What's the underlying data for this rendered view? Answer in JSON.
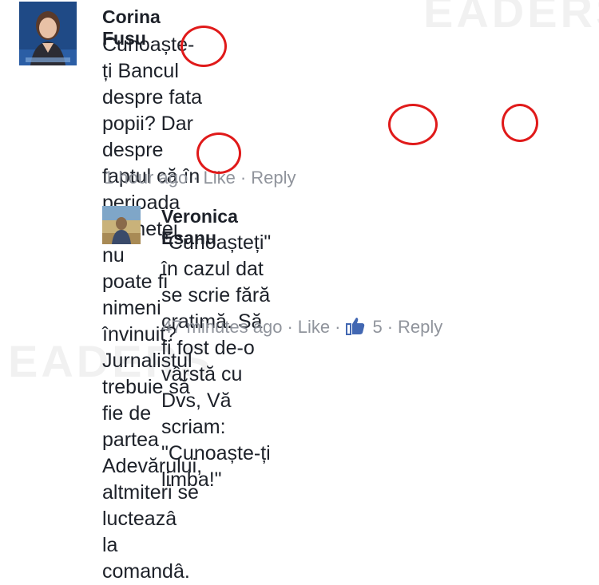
{
  "watermark": "EADERS",
  "comment1": {
    "author": "Corina Fusu",
    "lines": [
      "Cunoaște-ți Bancul despre fata popii? Dar",
      "despre faptul că în perioada anchetei nu",
      "poate fi nimeni învinuit? Jurnalistul trebuie să",
      "fie de partea Adevărului, altmiteri se lucteazâ",
      "la comandâ."
    ],
    "time": "1 hour ago",
    "like_label": "Like",
    "reply_label": "Reply"
  },
  "comment2": {
    "author": "Veronica Esanu",
    "lines": [
      "\"Cunoașteți\" în cazul dat se scrie fără",
      "cratimă. Să fi fost de-o vârstă cu Dvs, Vă",
      "scriam: \"Cunoaște-ți limba!\""
    ],
    "time": "47 minutes ago",
    "like_label": "Like",
    "like_count": "5",
    "reply_label": "Reply"
  },
  "colors": {
    "annotation": "#e01a1a",
    "meta": "#90949c",
    "text": "#1d2129",
    "like_icon": "#4267b2"
  }
}
